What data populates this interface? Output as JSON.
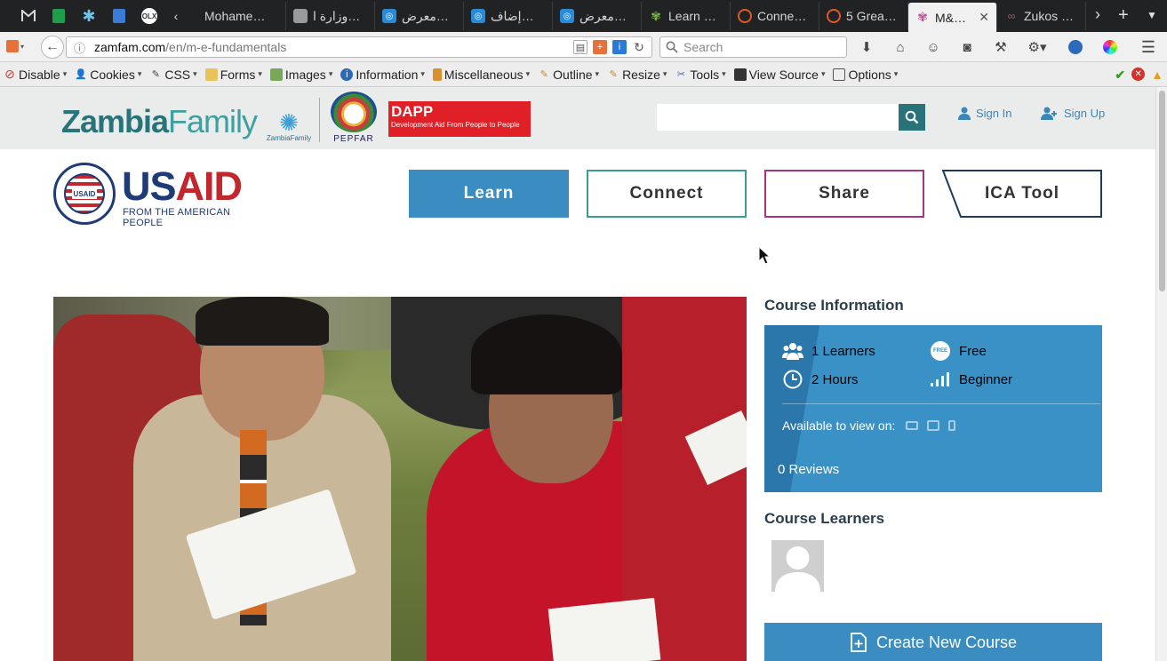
{
  "browser": {
    "tabs": [
      {
        "label": "Mohame…",
        "favicon_color": "#c05050"
      },
      {
        "label": "وزارة ا…",
        "favicon_color": "#888888"
      },
      {
        "label": "معرض…",
        "favicon_color": "#2a8ad8"
      },
      {
        "label": "إضاف…",
        "favicon_color": "#2a8ad8"
      },
      {
        "label": "معرض…",
        "favicon_color": "#2a8ad8"
      },
      {
        "label": "Learn …",
        "favicon_color": "#7ab648"
      },
      {
        "label": "Conne…",
        "favicon_color": "#e05a2a"
      },
      {
        "label": "5 Grea…",
        "favicon_color": "#e05a2a"
      },
      {
        "label": "M&…",
        "favicon_color": "#c04d9b"
      },
      {
        "label": "Zukos …",
        "favicon_color": "#8a5a5a"
      }
    ],
    "active_tab_index": 8,
    "url_host": "zamfam.com",
    "url_path": "/en/m-e-fundamentals",
    "search_placeholder": "Search"
  },
  "devtoolbar": {
    "items": [
      {
        "label": "Disable",
        "icon": "disable-icon",
        "color": "#d4322a"
      },
      {
        "label": "Cookies",
        "icon": "cookies-icon",
        "color": "#333333"
      },
      {
        "label": "CSS",
        "icon": "css-pencil-icon",
        "color": "#333333"
      },
      {
        "label": "Forms",
        "icon": "forms-icon",
        "color": "#c9a033"
      },
      {
        "label": "Images",
        "icon": "images-icon",
        "color": "#5a8a3a"
      },
      {
        "label": "Information",
        "icon": "information-icon",
        "color": "#2a6ab8"
      },
      {
        "label": "Miscellaneous",
        "icon": "miscellaneous-icon",
        "color": "#c9862a"
      },
      {
        "label": "Outline",
        "icon": "outline-icon",
        "color": "#c9a033"
      },
      {
        "label": "Resize",
        "icon": "resize-icon",
        "color": "#c9862a"
      },
      {
        "label": "Tools",
        "icon": "tools-icon",
        "color": "#555555"
      },
      {
        "label": "View Source",
        "icon": "view-source-icon",
        "color": "#333333"
      },
      {
        "label": "Options",
        "icon": "options-icon",
        "color": "#555555"
      }
    ]
  },
  "site": {
    "brand_part1": "Zambia",
    "brand_part2": "Family",
    "zf_small_label": "ZambiaFamily",
    "pepfar_label": "PEPFAR",
    "dapp_title": "DAPP",
    "dapp_subtitle": "Development Aid From People to People",
    "sign_in": "Sign In",
    "sign_up": "Sign Up",
    "usaid_us": "US",
    "usaid_aid": "AID",
    "usaid_tagline": "FROM THE AMERICAN PEOPLE",
    "usaid_seal_text": "USAID",
    "nav": {
      "learn": "Learn",
      "connect": "Connect",
      "share": "Share",
      "ica_tool": "ICA Tool"
    },
    "accent_blue": "#3b8cc1",
    "accent_teal": "#3b9c95",
    "accent_magenta": "#a63483"
  },
  "course": {
    "info_title": "Course Information",
    "learners": "1 Learners",
    "price": "Free",
    "free_badge": "FREE",
    "duration": "2 Hours",
    "level": "Beginner",
    "available_label": "Available to view on:",
    "reviews": "0 Reviews",
    "learners_title": "Course Learners",
    "create_button": "Create New Course"
  }
}
